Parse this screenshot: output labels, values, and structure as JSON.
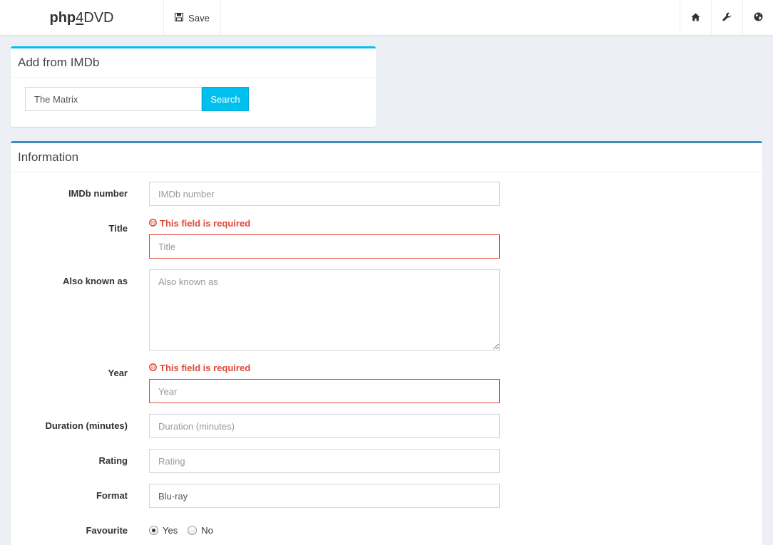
{
  "navbar": {
    "brand_part1": "php",
    "brand_part2": "4",
    "brand_part3": "DVD",
    "save_label": "Save",
    "icons": [
      "home-icon",
      "wrench-icon",
      "globe-icon"
    ]
  },
  "imdb": {
    "title": "Add from IMDb",
    "search_value": "The Matrix",
    "search_button": "Search"
  },
  "info": {
    "title": "Information",
    "fields": {
      "imdb": {
        "label": "IMDb number",
        "placeholder": "IMDb number",
        "value": ""
      },
      "title": {
        "label": "Title",
        "placeholder": "Title",
        "value": "",
        "error": "This field is required"
      },
      "aka": {
        "label": "Also known as",
        "placeholder": "Also known as",
        "value": ""
      },
      "year": {
        "label": "Year",
        "placeholder": "Year",
        "value": "",
        "error": "This field is required"
      },
      "duration": {
        "label": "Duration (minutes)",
        "placeholder": "Duration (minutes)",
        "value": ""
      },
      "rating": {
        "label": "Rating",
        "placeholder": "Rating",
        "value": ""
      },
      "format": {
        "label": "Format",
        "placeholder": "",
        "value": "Blu-ray"
      },
      "favourite": {
        "label": "Favourite",
        "options": [
          "Yes",
          "No"
        ],
        "selected": "Yes"
      }
    }
  },
  "colors": {
    "accent_info": "#00c0ef",
    "accent_primary": "#3c8dbc",
    "error": "#dd4b39",
    "background": "#ecf0f5"
  }
}
